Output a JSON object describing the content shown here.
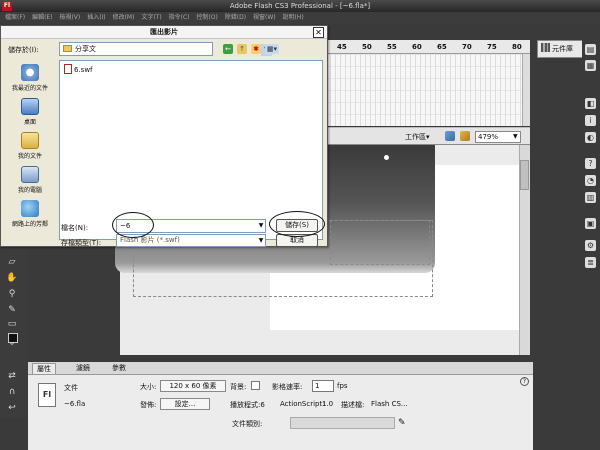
{
  "app": {
    "logo": "Fl",
    "title": "Adobe Flash CS3 Professional - [~6.fla*]",
    "menu": [
      "檔案(F)",
      "編輯(E)",
      "檢視(V)",
      "插入(I)",
      "修改(M)",
      "文字(T)",
      "指令(C)",
      "控制(O)",
      "除錯(D)",
      "視窗(W)",
      "說明(H)"
    ]
  },
  "timeline": {
    "ruler": [
      "45",
      "50",
      "55",
      "60",
      "65",
      "70",
      "75",
      "80"
    ]
  },
  "edit_bar": {
    "workspace_label": "工作區▾",
    "zoom": "479%"
  },
  "library": {
    "label": "元件庫"
  },
  "dialog": {
    "title": "匯出影片",
    "save_in_label": "儲存於(I):",
    "save_in_value": "分享文",
    "places": [
      "我最近的文件",
      "桌面",
      "我的文件",
      "我的電腦",
      "網路上的芳鄰"
    ],
    "files": [
      "6.swf"
    ],
    "filename_label": "檔名(N):",
    "filename_value": "~6",
    "filetype_label": "存檔類型(T):",
    "filetype_value": "Flash 影片 (*.swf)",
    "save_button": "儲存(S)",
    "cancel_button": "取消",
    "close": "✕"
  },
  "properties": {
    "tabs": [
      "屬性",
      "濾鏡",
      "參數"
    ],
    "doc_label": "文件",
    "doc_name": "~6.fla",
    "doc_icon": "Fl",
    "size_label": "大小:",
    "size_value": "120 x 60 像素",
    "publish_label": "發佈:",
    "settings_button": "設定...",
    "background_label": "背景:",
    "fps_label": "影格速率:",
    "fps_value": "1",
    "fps_unit": "fps",
    "player_label": "播放程式:6",
    "actionscript_label": "ActionScript:",
    "actionscript_value": "1.0",
    "profile_label": "描述檔:",
    "profile_value": "Flash CS...",
    "doc_class_label": "文件類別:",
    "help": "?"
  }
}
